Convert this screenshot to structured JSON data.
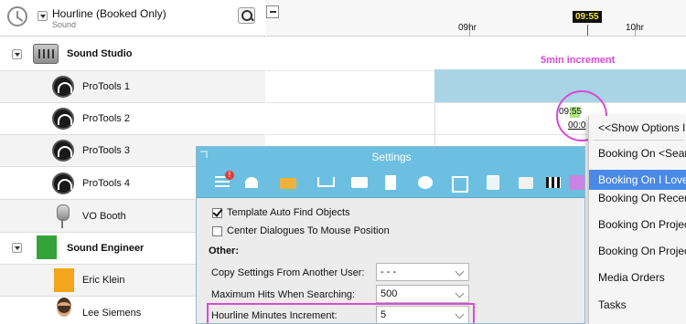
{
  "header": {
    "title": "Hourline (Booked Only)",
    "subtitle": "Sound"
  },
  "timeline": {
    "hours": [
      "09hr",
      "10hr"
    ],
    "now_time": "09:55",
    "annotation": "5min increment",
    "cursor_time_a": "09:55",
    "cursor_time_b": "00:0"
  },
  "groups": [
    {
      "name": "Sound Studio",
      "icon": "mixing-desk-icon",
      "items": [
        {
          "label": "ProTools 1",
          "icon": "protools-icon"
        },
        {
          "label": "ProTools 2",
          "icon": "protools-icon"
        },
        {
          "label": "ProTools 3",
          "icon": "protools-icon"
        },
        {
          "label": "ProTools 4",
          "icon": "protools-icon"
        },
        {
          "label": "VO Booth",
          "icon": "microphone-icon"
        }
      ]
    },
    {
      "name": "Sound Engineer",
      "icon": "person-icon",
      "items": [
        {
          "label": "Eric Klein",
          "icon": "person-icon"
        },
        {
          "label": "Lee Siemens",
          "icon": "avatar-icon"
        }
      ]
    }
  ],
  "context_menu": {
    "items": [
      "<<Show Options In",
      "Booking On <Sear",
      "Booking On I Love",
      "Booking On Recen",
      "Booking On Projec",
      "Booking On Projec",
      "Media Orders",
      "Tasks"
    ],
    "selected_index": 2
  },
  "settings": {
    "title": "Settings",
    "toolbar_badge": "!",
    "toolbar_icons": [
      "list-alert-icon",
      "service-bell-icon",
      "briefcase-icon",
      "cart-icon",
      "id-card-icon",
      "document-icon",
      "group-icon",
      "duplicate-icon",
      "history-icon",
      "trash-icon",
      "box-icon",
      "clapper-icon",
      "purple-tag-icon"
    ],
    "checkboxes": [
      {
        "label": "Template Auto Find Objects",
        "checked": true
      },
      {
        "label": "Center Dialogues To Mouse Position",
        "checked": false
      }
    ],
    "section_other": "Other:",
    "fields": [
      {
        "label": "Copy Settings From Another User:",
        "value": "- - -"
      },
      {
        "label": "Maximum Hits When Searching:",
        "value": "500"
      },
      {
        "label": "Hourline Minutes Increment:",
        "value": "5"
      }
    ]
  },
  "colors": {
    "booking": "#a8d4e4",
    "highlight": "#d94ad4",
    "settings_bar": "#6cbfe0",
    "menu_selected": "#4a8ae6"
  }
}
